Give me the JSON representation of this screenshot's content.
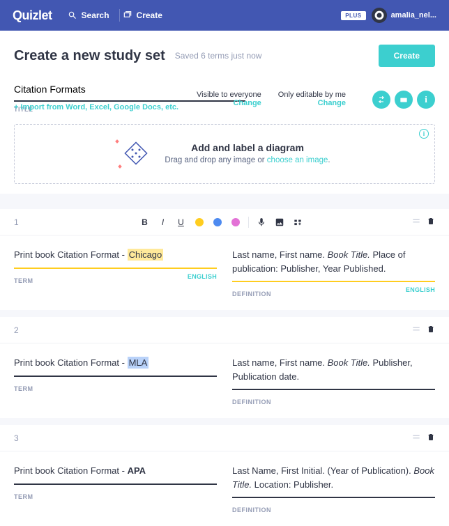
{
  "brand": "Quizlet",
  "nav": {
    "search": "Search",
    "create": "Create",
    "plus": "PLUS",
    "username": "amalia_nel..."
  },
  "page": {
    "heading": "Create a new study set",
    "saved": "Saved 6 terms just now",
    "create_btn": "Create",
    "title_value": "Citation Formats",
    "title_label": "TITLE",
    "import_link": "+ Import from Word, Excel, Google Docs, etc."
  },
  "visibility": {
    "who_see": "Visible to everyone",
    "who_edit": "Only editable by me",
    "change": "Change"
  },
  "diagram": {
    "title": "Add and label a diagram",
    "sub_pre": "Drag and drop any image or ",
    "link": "choose an image",
    "sub_post": "."
  },
  "labels": {
    "term": "TERM",
    "definition": "DEFINITION",
    "english": "ENGLISH"
  },
  "cards": [
    {
      "num": "1",
      "term_prefix": "Print book Citation Format - ",
      "term_hl": "Chicago",
      "term_hl_class": "hl-y",
      "term_border": "hl",
      "def_pre": "Last name, First name. ",
      "def_ital": "Book Title.",
      "def_post": " Place of publication: Publisher, Year Published.",
      "def_border": "hl",
      "show_lang": true,
      "show_toolbar": true
    },
    {
      "num": "2",
      "term_prefix": "Print book Citation Format - ",
      "term_hl": "MLA",
      "term_hl_class": "hl-b",
      "term_border": "",
      "def_pre": "Last name, First name. ",
      "def_ital": "Book Title.",
      "def_post": " Publisher, Publication date.",
      "def_border": "",
      "show_lang": false,
      "show_toolbar": false
    },
    {
      "num": "3",
      "term_prefix": "Print book Citation Format - ",
      "term_hl": "APA",
      "term_hl_class": "bold",
      "term_border": "",
      "def_pre": "Last Name, First Initial. (Year of Publication). ",
      "def_ital": "Book Title.",
      "def_post": " Location: Publisher.",
      "def_border": "",
      "show_lang": false,
      "show_toolbar": false
    }
  ]
}
